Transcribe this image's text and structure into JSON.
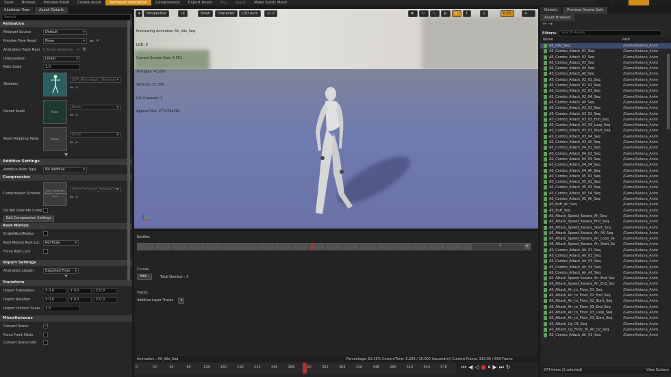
{
  "toolbar": {
    "items": [
      "Save",
      "Browse",
      "Preview Mesh",
      "Create Asset",
      "Reimport Animation",
      "Compression",
      "Export Asset",
      "Key",
      "Apply",
      "Make Static Mesh"
    ]
  },
  "left_panel": {
    "tabs": [
      "Skeleton Tree",
      "Asset Details"
    ],
    "search_placeholder": "Search",
    "animation": {
      "header": "Animation",
      "retarget_source_label": "Retarget Source",
      "retarget_source_value": "Default",
      "preview_pose_label": "Preview Pose Asset",
      "preview_pose_value": "None",
      "anim_track_label": "Animation Track Nam",
      "anim_track_value": "0 Array elements",
      "interpolation_label": "Interpolation",
      "interpolation_value": "Linear",
      "rate_scale_label": "Rate Scale",
      "rate_scale_value": "1.0",
      "skeleton_label": "Skeleton",
      "skeleton_value": "UE4_Mannequin_Skeleton",
      "parent_asset_label": "Parent Asset",
      "parent_asset_value": "None",
      "parent_thumb": "None",
      "mapping_label": "Asset Mapping Table",
      "mapping_value": "None",
      "mapping_thumb": "None"
    },
    "additive": {
      "header": "Additive Settings",
      "type_label": "Additive Anim Type",
      "type_value": "No additive"
    },
    "compression": {
      "header": "Compression",
      "scheme_label": "Compression Scheme",
      "scheme_value": "AnimCompress_BitwiseCom",
      "thumb": "Anim Compress Bitwise Compress Only",
      "no_override_label": "Do Not Override Comp",
      "edit_button": "Edit Compression Settings"
    },
    "root_motion": {
      "header": "Root Motion",
      "enable_label": "EnableRootMotion",
      "lock_label": "Root Motion Root Loc",
      "lock_value": "Ref Pose",
      "force_label": "Force Root Lock"
    },
    "import": {
      "header": "Import Settings",
      "length_label": "Animation Length",
      "length_value": "Exported Time"
    },
    "transform": {
      "header": "Transform",
      "translation_label": "Import Translation",
      "rotation_label": "Import Rotation",
      "scale_label": "Import Uniform Scale",
      "scale_value": "1.0",
      "x_value": "X 0.0",
      "y_value": "Y 0.0",
      "z_value": "Z 0.0"
    },
    "misc": {
      "header": "Miscellaneous",
      "convert_label": "Convert Scene",
      "force_front_label": "Force Front XAxis",
      "convert_unit_label": "Convert Scene Unit"
    }
  },
  "viewport": {
    "buttons": [
      "Perspective",
      "Lit",
      "Show",
      "Character",
      "LOD Auto",
      "x1.0"
    ],
    "right_values": [
      "0.25",
      "4"
    ],
    "info": [
      "Previewing Animation AS_Idle_Seq",
      "LOD: 0",
      "Current Screen Size: 1.001",
      "Triangles: 41,002",
      "Vertices: 23,309",
      "UV Channels: 1",
      "Approx Size: 277x78x283"
    ]
  },
  "timeline": {
    "notifies_label": "Notifies",
    "notify_track_value": "1",
    "curves_label": "Curves",
    "add_button": "Add...",
    "total_number": "Total Number : 0",
    "tracks_label": "Tracks",
    "additive_layer": "Additive Layer Tracks",
    "status_animation": "Animation :  AS_Idle_Seq",
    "status_percentage": "Percentage:  52.39% CurrentTime:  5.239 / 10.000 (second(s)) Current Frame:  314.36 / 600 Frame",
    "ruler": [
      "0",
      "32",
      "64",
      "96",
      "128",
      "160",
      "192",
      "224",
      "256",
      "288",
      "320",
      "352",
      "384",
      "416",
      "448",
      "480",
      "512",
      "544",
      "576"
    ],
    "playhead_fraction": 0.524
  },
  "right_panel": {
    "tabs": [
      "Details",
      "Preview Scene Sett"
    ],
    "asset_tab": "Asset Browser",
    "filters_label": "Filters",
    "search_placeholder": "Search Assets",
    "col_name": "Name",
    "col_path": "Path",
    "items_count": "274 items (1 selected)",
    "view_options": "View Options",
    "assets": [
      {
        "n": "AS_Idle_Seq",
        "p": "/Game/Katana_Anim"
      },
      {
        "n": "AS_Combo_Attack_01_Seq",
        "p": "/Game/Katana_Anim"
      },
      {
        "n": "AS_Combo_Attack_02_Seq",
        "p": "/Game/Katana_Anim"
      },
      {
        "n": "AS_Combo_Attack_03_Seq",
        "p": "/Game/Katana_Anim"
      },
      {
        "n": "AS_Combo_Attack_04_Seq",
        "p": "/Game/Katana_Anim"
      },
      {
        "n": "AS_Combo_Attack_All_Seq",
        "p": "/Game/Katana_Anim"
      },
      {
        "n": "AS_Combo_Attack_02_01_Seq",
        "p": "/Game/Katana_Anim"
      },
      {
        "n": "AS_Combo_Attack_02_02_Seq",
        "p": "/Game/Katana_Anim"
      },
      {
        "n": "AS_Combo_Attack_02_03_Seq",
        "p": "/Game/Katana_Anim"
      },
      {
        "n": "AS_Combo_Attack_02_04_Seq",
        "p": "/Game/Katana_Anim"
      },
      {
        "n": "AS_Combo_Attack_All_Seq",
        "p": "/Game/Katana_Anim"
      },
      {
        "n": "AS_Combo_Attack_03_01_Seq",
        "p": "/Game/Katana_Anim"
      },
      {
        "n": "AS_Combo_Attack_03_02_Seq",
        "p": "/Game/Katana_Anim"
      },
      {
        "n": "AS_Combo_Attack_03_03_End_Seq",
        "p": "/Game/Katana_Anim"
      },
      {
        "n": "AS_Combo_Attack_03_03_Loop_Seq",
        "p": "/Game/Katana_Anim"
      },
      {
        "n": "AS_Combo_Attack_03_03_Start_Seq",
        "p": "/Game/Katana_Anim"
      },
      {
        "n": "AS_Combo_Attack_03_04_Seq",
        "p": "/Game/Katana_Anim"
      },
      {
        "n": "AS_Combo_Attack_03_All_Seq",
        "p": "/Game/Katana_Anim"
      },
      {
        "n": "AS_Combo_Attack_04_01_Seq",
        "p": "/Game/Katana_Anim"
      },
      {
        "n": "AS_Combo_Attack_04_02_Seq",
        "p": "/Game/Katana_Anim"
      },
      {
        "n": "AS_Combo_Attack_04_03_Seq",
        "p": "/Game/Katana_Anim"
      },
      {
        "n": "AS_Combo_Attack_04_04_Seq",
        "p": "/Game/Katana_Anim"
      },
      {
        "n": "AS_Combo_Attack_04_All_Seq",
        "p": "/Game/Katana_Anim"
      },
      {
        "n": "AS_Combo_Attack_05_01_Seq",
        "p": "/Game/Katana_Anim"
      },
      {
        "n": "AS_Combo_Attack_05_02_Seq",
        "p": "/Game/Katana_Anim"
      },
      {
        "n": "AS_Combo_Attack_05_03_Seq",
        "p": "/Game/Katana_Anim"
      },
      {
        "n": "AS_Combo_Attack_05_04_Seq",
        "p": "/Game/Katana_Anim"
      },
      {
        "n": "AS_Combo_Attack_05_All_Seq",
        "p": "/Game/Katana_Anim"
      },
      {
        "n": "AS_Buff_Air_Seq",
        "p": "/Game/Katana_Anim"
      },
      {
        "n": "AS_Buff_Seq",
        "p": "/Game/Katana_Anim"
      },
      {
        "n": "AS_Attack_Speed_Katana_All_Seq",
        "p": "/Game/Katana_Anim"
      },
      {
        "n": "AS_Attack_Speed_Katana_End_Seq",
        "p": "/Game/Katana_Anim"
      },
      {
        "n": "AS_Attack_Speed_Katana_Start_Seq",
        "p": "/Game/Katana_Anim"
      },
      {
        "n": "AS_Attack_Speed_Katana_Air_All_Seq",
        "p": "/Game/Katana_Anim"
      },
      {
        "n": "AS_Attack_Speed_Katana_Air_Loop_Se",
        "p": "/Game/Katana_Anim"
      },
      {
        "n": "AS_Attack_Speed_Katana_Air_Start_Se",
        "p": "/Game/Katana_Anim"
      },
      {
        "n": "AS_Combo_Attack_Air_01_Seq",
        "p": "/Game/Katana_Anim"
      },
      {
        "n": "AS_Combo_Attack_Air_02_Seq",
        "p": "/Game/Katana_Anim"
      },
      {
        "n": "AS_Combo_Attack_Air_03_Seq",
        "p": "/Game/Katana_Anim"
      },
      {
        "n": "AS_Combo_Attack_Air_04_Seq",
        "p": "/Game/Katana_Anim"
      },
      {
        "n": "AS_Combo_Attack_Air_All_Seq",
        "p": "/Game/Katana_Anim"
      },
      {
        "n": "AS_Attack_Speed_Katana_Air_End_Sec",
        "p": "/Game/Katana_Anim"
      },
      {
        "n": "AS_Attack_Speed_Katana_Air_End_Sec",
        "p": "/Game/Katana_Anim"
      },
      {
        "n": "AS_Attack_Air_to_Floor_01_Seq",
        "p": "/Game/Katana_Anim"
      },
      {
        "n": "AS_Attack_Air_to_Floor_02_End_Seq",
        "p": "/Game/Katana_Anim"
      },
      {
        "n": "AS_Attack_Air_to_Floor_02_Start_Seq",
        "p": "/Game/Katana_Anim"
      },
      {
        "n": "AS_Attack_Air_to_Floor_03_End_Seq",
        "p": "/Game/Katana_Anim"
      },
      {
        "n": "AS_Attack_Air_to_Floor_03_Loop_Seq",
        "p": "/Game/Katana_Anim"
      },
      {
        "n": "AS_Attack_Air_to_Floor_03_Start_Seq",
        "p": "/Game/Katana_Anim"
      },
      {
        "n": "AS_Attack_Up_01_Seq",
        "p": "/Game/Katana_Anim"
      },
      {
        "n": "AS_Attack_Up_Floor_To_Air_02_Seq",
        "p": "/Game/Katana_Anim"
      },
      {
        "n": "AS_Combo_Attack_Air_01_Seq",
        "p": "/Game/Katana_Anim"
      }
    ]
  },
  "colors": {
    "accent": "#d08d1a",
    "viewport_floor": "#6c73a6",
    "selection": "#3c4a6b"
  }
}
